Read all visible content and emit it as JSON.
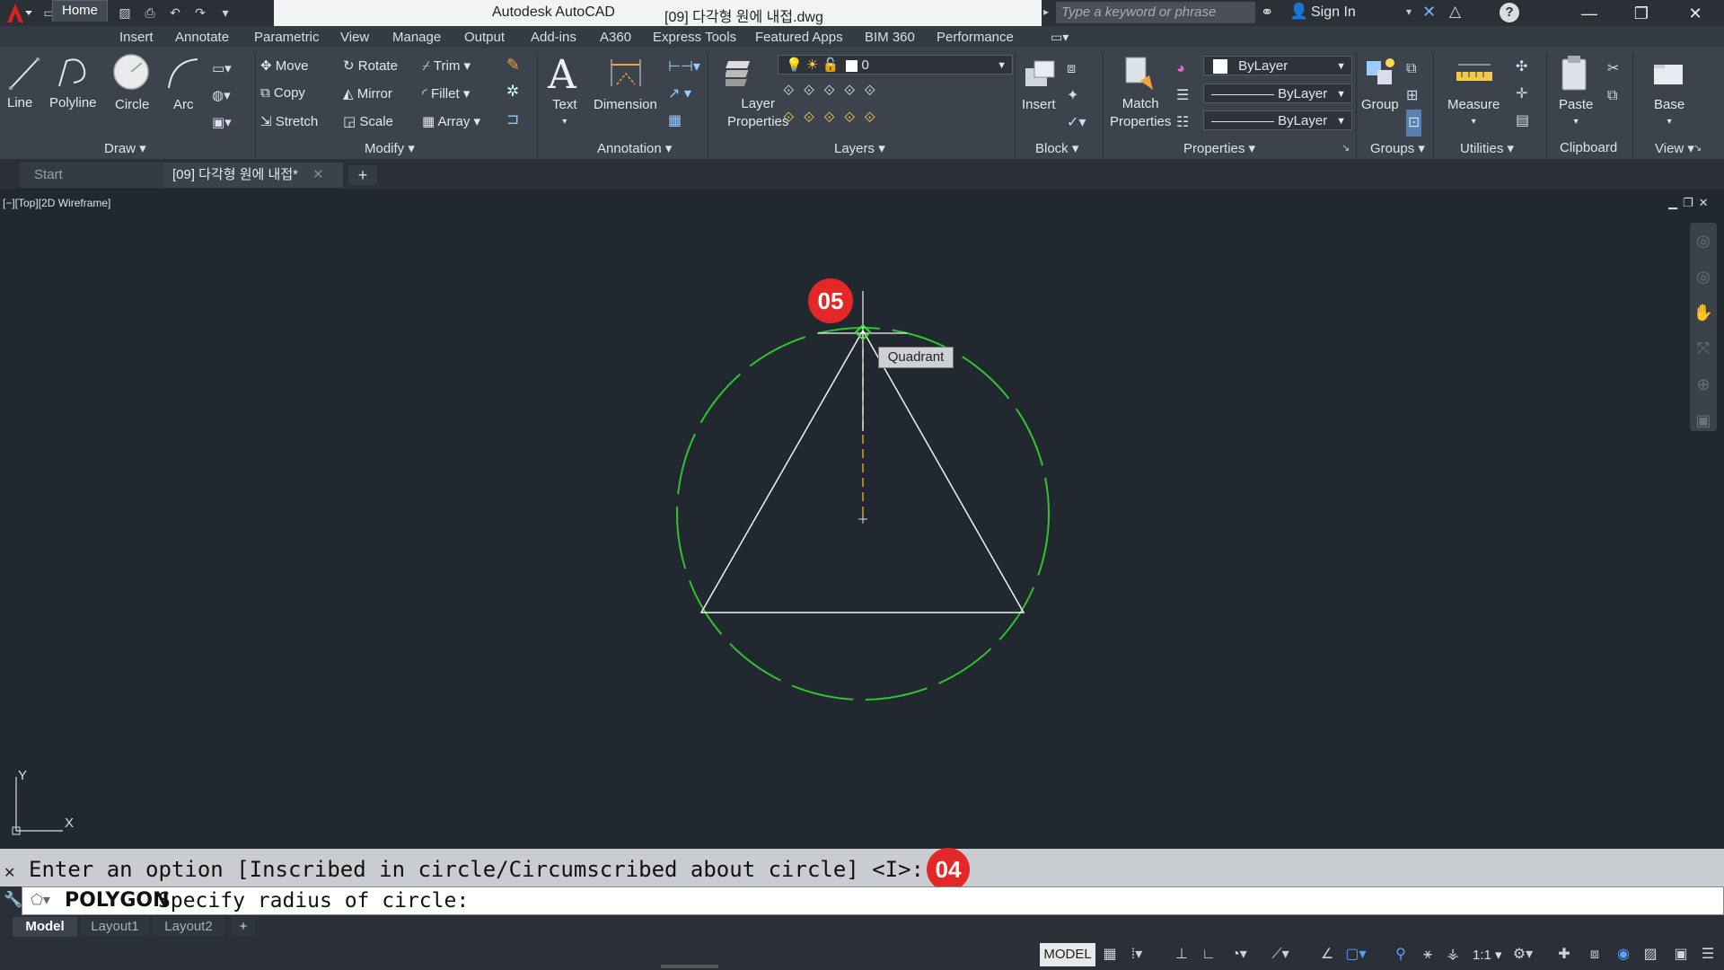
{
  "app": {
    "title": "Autodesk AutoCAD",
    "file": "[09] 다각형 원에 내접.dwg",
    "search_placeholder": "Type a keyword or phrase",
    "sign_in": "Sign In"
  },
  "menu_tabs": [
    "Home",
    "Insert",
    "Annotate",
    "Parametric",
    "View",
    "Manage",
    "Output",
    "Add-ins",
    "A360",
    "Express Tools",
    "Featured Apps",
    "BIM 360",
    "Performance"
  ],
  "ribbon": {
    "draw": {
      "title": "Draw",
      "line": "Line",
      "polyline": "Polyline",
      "circle": "Circle",
      "arc": "Arc"
    },
    "modify": {
      "title": "Modify",
      "move": "Move",
      "rotate": "Rotate",
      "trim": "Trim",
      "copy": "Copy",
      "mirror": "Mirror",
      "fillet": "Fillet",
      "stretch": "Stretch",
      "scale": "Scale",
      "array": "Array"
    },
    "annotation": {
      "title": "Annotation",
      "text": "Text",
      "dimension": "Dimension"
    },
    "layers": {
      "title": "Layers",
      "layer_properties_1": "Layer",
      "layer_properties_2": "Properties",
      "current_layer": "0"
    },
    "block": {
      "title": "Block",
      "insert": "Insert"
    },
    "properties": {
      "title": "Properties",
      "match_1": "Match",
      "match_2": "Properties",
      "color": "ByLayer",
      "linetype": "ByLayer",
      "lineweight": "ByLayer"
    },
    "groups": {
      "title": "Groups",
      "group": "Group"
    },
    "utilities": {
      "title": "Utilities",
      "measure": "Measure"
    },
    "clipboard": {
      "title": "Clipboard",
      "paste": "Paste"
    },
    "view": {
      "title": "View",
      "base": "Base"
    }
  },
  "file_tabs": {
    "start": "Start",
    "current": "[09] 다각형 원에 내접*"
  },
  "viewport": {
    "label": "[−][Top][2D Wireframe]",
    "tooltip": "Quadrant",
    "axis_x": "X",
    "axis_y": "Y"
  },
  "command": {
    "history": "Enter an option [Inscribed in circle/Circumscribed about circle] <I>: I",
    "prefix": "POLYGON",
    "prompt": "Specify radius of circle:"
  },
  "layout_tabs": [
    "Model",
    "Layout1",
    "Layout2"
  ],
  "status": {
    "model": "MODEL",
    "scale": "1:1"
  },
  "badges": {
    "step_a": "05",
    "step_b": "04"
  },
  "colors": {
    "circle": "#2fc42f",
    "accent": "#e42727",
    "canvas": "#212830"
  }
}
